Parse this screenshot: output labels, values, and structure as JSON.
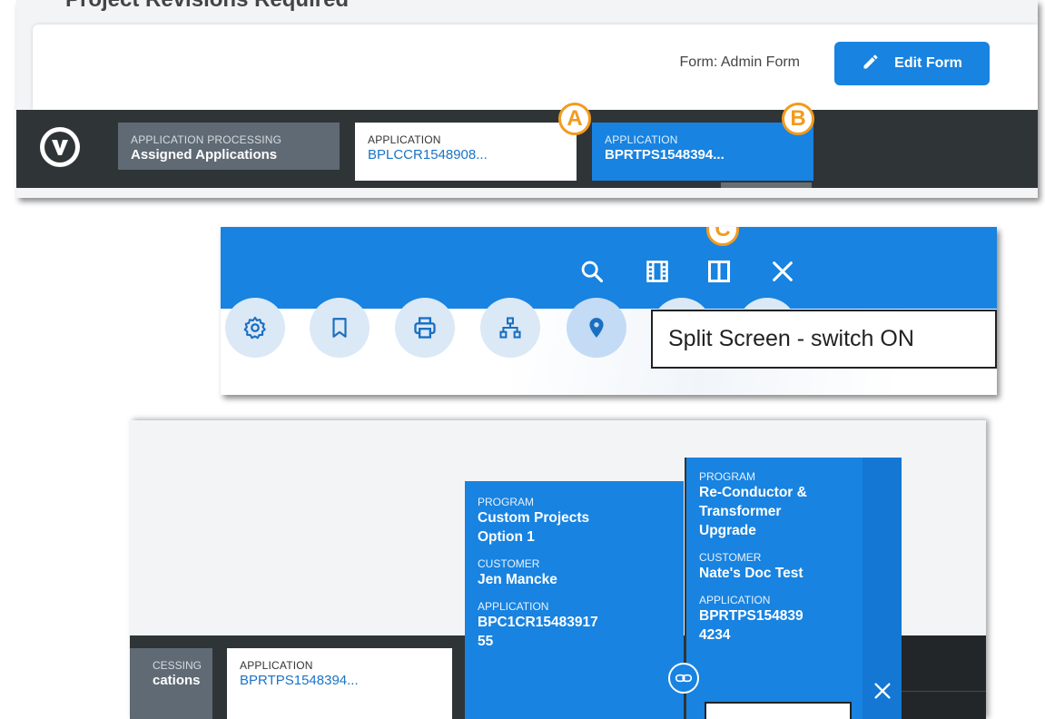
{
  "panel1": {
    "page_title": "Project Revisions Required",
    "form_label": "Form: Admin Form",
    "edit_button": "Edit Form",
    "tabs": [
      {
        "category": "APPLICATION PROCESSING",
        "name": "Assigned Applications"
      },
      {
        "category": "APPLICATION",
        "name": "BPLCCR1548908..."
      },
      {
        "category": "APPLICATION",
        "name": "BPRTPS1548394..."
      }
    ],
    "markers": {
      "a": "A",
      "b": "B"
    }
  },
  "panel2": {
    "marker_c": "C",
    "tooltip": "Split Screen - switch ON",
    "toolbar_icons": [
      "search-icon",
      "filmstrip-icon",
      "split-screen-icon",
      "close-icon"
    ],
    "action_icons": [
      "settings-icon",
      "bookmark-icon",
      "print-icon",
      "hierarchy-icon",
      "location-pin-icon"
    ]
  },
  "panel3": {
    "tabs": [
      {
        "category": "CESSING",
        "name": "cations"
      },
      {
        "category": "APPLICATION",
        "name": "BPRTPS1548394..."
      }
    ],
    "card_left": {
      "program_label": "PROGRAM",
      "program_lines": [
        "Custom Projects",
        "Option 1"
      ],
      "customer_label": "CUSTOMER",
      "customer": "Jen Mancke",
      "application_label": "APPLICATION",
      "application_lines": [
        "BPC1CR15483917",
        "55"
      ]
    },
    "card_right": {
      "program_label": "PROGRAM",
      "program_lines": [
        "Re-Conductor &",
        "Transformer",
        "Upgrade"
      ],
      "customer_label": "CUSTOMER",
      "customer": "Nate's Doc Test",
      "application_label": "APPLICATION",
      "application_lines": [
        "BPRTPS154839",
        "4234"
      ]
    }
  },
  "colors": {
    "accent_blue": "#1883e0",
    "dark_bar": "#2f3437",
    "marker_orange": "#f29b1d"
  }
}
